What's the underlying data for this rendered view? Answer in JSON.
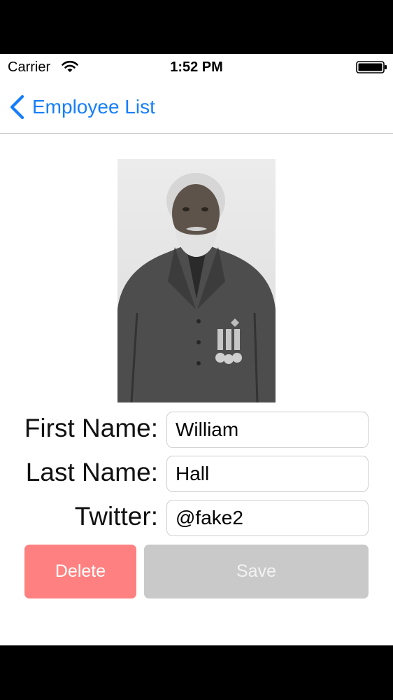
{
  "status_bar": {
    "carrier": "Carrier",
    "time": "1:52 PM",
    "wifi_icon": "wifi-icon",
    "battery_icon": "battery-icon"
  },
  "nav": {
    "back_label": "Employee List",
    "back_icon": "chevron-left-icon"
  },
  "employee": {
    "photo": "employee-photo",
    "first_name_label": "First Name:",
    "first_name": "William",
    "last_name_label": "Last Name:",
    "last_name": "Hall",
    "twitter_label": "Twitter:",
    "twitter": "@fake2"
  },
  "actions": {
    "delete_label": "Delete",
    "save_label": "Save"
  },
  "colors": {
    "accent": "#157efb",
    "delete": "#ff8080",
    "save_disabled": "#c9c9c9"
  }
}
